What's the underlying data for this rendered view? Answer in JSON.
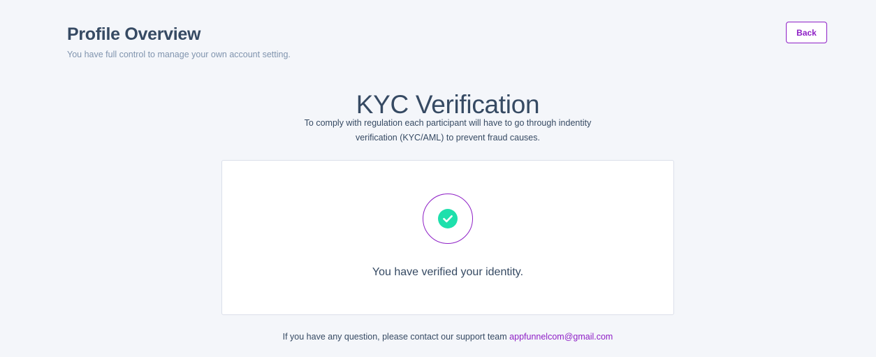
{
  "header": {
    "title": "Profile Overview",
    "subtitle": "You have full control to manage your own account setting.",
    "back_label": "Back"
  },
  "kyc": {
    "title": "KYC Verification",
    "description": "To comply with regulation each participant will have to go through indentity verification (KYC/AML) to prevent fraud causes."
  },
  "status_card": {
    "icon": "check-circle-icon",
    "message": "You have verified your identity."
  },
  "support": {
    "text": "If you have any question, please contact our support team",
    "email": "appfunnelcom@gmail.com"
  },
  "colors": {
    "accent": "#8e1fc6",
    "success": "#1ee0ac",
    "heading": "#364a63",
    "muted": "#8094ae",
    "background": "#f4f6fa"
  }
}
